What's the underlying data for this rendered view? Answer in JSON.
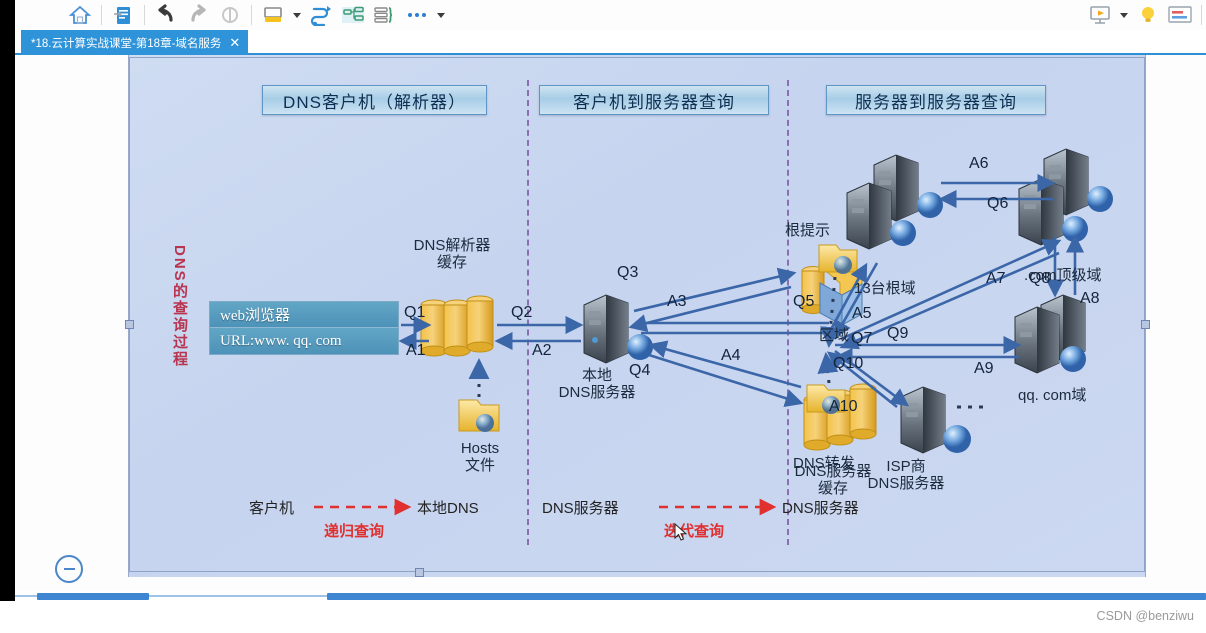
{
  "window": {
    "tab_title": "*18.云计算实战课堂-第18章-域名服务",
    "tab_close": "✕"
  },
  "toolbar": {
    "items": [
      {
        "name": "home-icon",
        "label": "主页"
      },
      {
        "name": "new-document-icon",
        "label": "新建"
      },
      {
        "name": "undo-icon",
        "label": "撤销"
      },
      {
        "name": "redo-icon",
        "label": "重做"
      },
      {
        "name": "fill-color-icon",
        "label": "填充颜色"
      },
      {
        "name": "fill-color-dropdown",
        "label": "▾"
      },
      {
        "name": "connector-icon",
        "label": "连接线"
      },
      {
        "name": "layout-tree-icon",
        "label": "布局"
      },
      {
        "name": "brace-list-icon",
        "label": "列表"
      },
      {
        "name": "more-icon",
        "label": "更多"
      },
      {
        "name": "more-dropdown",
        "label": "▾"
      },
      {
        "name": "present-icon",
        "label": "演示"
      },
      {
        "name": "present-dropdown",
        "label": "▾"
      },
      {
        "name": "idea-bulb-icon",
        "label": "提示"
      },
      {
        "name": "panel-icon",
        "label": "面板"
      }
    ]
  },
  "diagram": {
    "vertical_label": "DNS的查询过程",
    "sections": [
      {
        "id": "client",
        "title": "DNS客户机（解析器）"
      },
      {
        "id": "client-server",
        "title": "客户机到服务器查询"
      },
      {
        "id": "server-server",
        "title": "服务器到服务器查询"
      }
    ],
    "browser": {
      "line1": "web浏览器",
      "line2": "URL:www. qq. com"
    },
    "nodes": [
      {
        "name": "dns-resolver-cache",
        "line1": "DNS解析器",
        "line2": "缓存"
      },
      {
        "name": "hosts-file",
        "line1": "Hosts",
        "line2": "文件"
      },
      {
        "name": "local-dns-server",
        "line1": "本地",
        "line2": "DNS服务器"
      },
      {
        "name": "zone",
        "line1": "区域",
        "line2": ""
      },
      {
        "name": "dns-server-cache",
        "line1": "DNS服务器",
        "line2": "缓存"
      },
      {
        "name": "root-hint",
        "line1": "根提示",
        "line2": ""
      },
      {
        "name": "root-domain",
        "line1": "13台根域",
        "line2": ""
      },
      {
        "name": "com-tld",
        "line1": ".com顶级域",
        "line2": ""
      },
      {
        "name": "qq-com-domain",
        "line1": "qq. com域",
        "line2": ""
      },
      {
        "name": "dns-forward",
        "line1": "DNS转发",
        "line2": ""
      },
      {
        "name": "isp-dns-server",
        "line1": "ISP商",
        "line2": "DNS服务器"
      }
    ],
    "flow_labels": [
      "Q1",
      "A1",
      "Q2",
      "A2",
      "Q3",
      "A3",
      "Q4",
      "A4",
      "Q5",
      "A5",
      "A6",
      "Q6",
      "A7",
      "Q7",
      "Q8",
      "A8",
      "Q9",
      "A9",
      "Q10",
      "A10"
    ],
    "legend": {
      "left_from": "客户机",
      "left_to": "本地DNS",
      "left_label": "递归查询",
      "right_from": "DNS服务器",
      "right_to": "DNS服务器",
      "right_label": "迭代查询"
    }
  },
  "status": {
    "watermark": "CSDN @benziwu"
  },
  "colors": {
    "accent_blue": "#2f93da",
    "slide_bg": "#cbd8f0",
    "red_label": "#e03030",
    "vertical_label": "#b8344f"
  }
}
